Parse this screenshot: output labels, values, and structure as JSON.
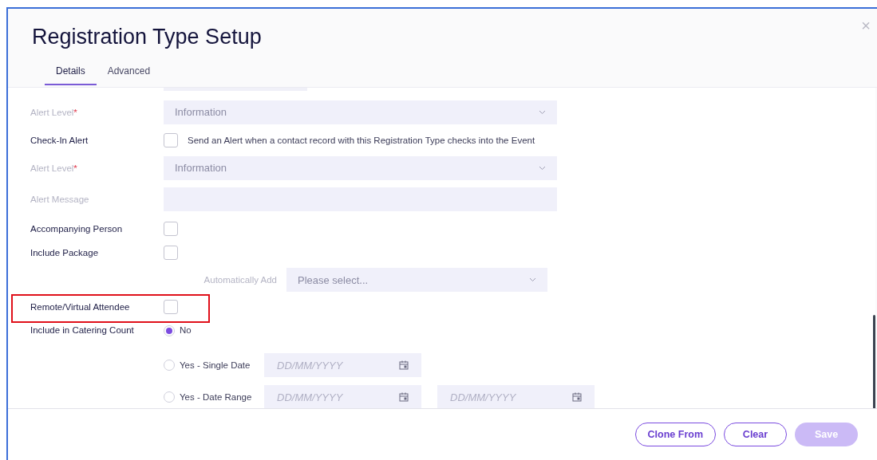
{
  "dialog": {
    "title": "Registration Type Setup",
    "close": "×"
  },
  "tabs": [
    {
      "label": "Details",
      "selected": true
    },
    {
      "label": "Advanced",
      "selected": false
    }
  ],
  "rows": [
    {
      "kind": "select",
      "label": "Alert Level",
      "required": "*",
      "disabled": true,
      "value": "Information"
    },
    {
      "kind": "checkbox",
      "label": "Check-In Alert",
      "disabled": false,
      "checked": false,
      "text": "Send an Alert when a contact record with this Registration Type checks into the Event"
    },
    {
      "kind": "select",
      "label": "Alert Level",
      "required": "*",
      "disabled": true,
      "value": "Information"
    },
    {
      "kind": "text",
      "label": "Alert Message",
      "disabled": true
    },
    {
      "kind": "checkbox",
      "label": "Accompanying Person",
      "disabled": false,
      "checked": false
    },
    {
      "kind": "checkbox",
      "label": "Include Package",
      "disabled": false,
      "checked": false
    },
    {
      "kind": "subselect",
      "label": "Automatically Add",
      "disabled": true,
      "placeholder": "Please select..."
    },
    {
      "kind": "checkbox",
      "label": "Remote/Virtual Attendee",
      "disabled": false,
      "checked": false,
      "highlighted": true
    },
    {
      "kind": "radio",
      "label": "Include in Catering Count",
      "disabled": false,
      "options": [
        {
          "label": "No",
          "selected": true
        },
        {
          "label": "Yes - Single Date",
          "selected": false,
          "dates": [
            "DD/MM/YYYY"
          ]
        },
        {
          "label": "Yes - Date Range",
          "selected": false,
          "dates": [
            "DD/MM/YYYY",
            "DD/MM/YYYY"
          ]
        }
      ]
    }
  ],
  "buttons": [
    {
      "label": "Clone From",
      "kind": "outline",
      "disabled": false
    },
    {
      "label": "Clear",
      "kind": "outline",
      "disabled": false
    },
    {
      "label": "Save",
      "kind": "primary",
      "disabled": true
    }
  ]
}
